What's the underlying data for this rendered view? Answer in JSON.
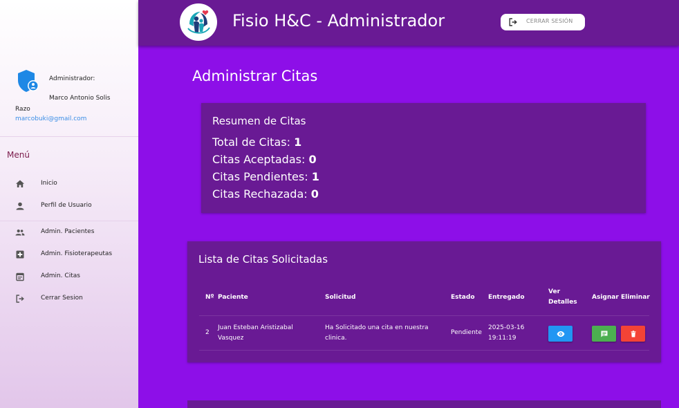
{
  "header": {
    "app_title": "Fisio H&C - Administrador",
    "logout_label": "CERRAR SESIÓN"
  },
  "sidebar": {
    "role_label": "Administrador:",
    "user_name": "Marco Antonio Solis Razo",
    "email": "marcobuki@gmail.com",
    "menu_title": "Menú",
    "items": [
      {
        "label": "Inicio",
        "icon": "home-icon"
      },
      {
        "label": "Perfil de Usuario",
        "icon": "person-icon"
      },
      {
        "label": "Admin. Pacientes",
        "icon": "group-icon"
      },
      {
        "label": "Admin. Fisioterapeutas",
        "icon": "medical-plus-icon"
      },
      {
        "label": "Admin. Citas",
        "icon": "calendar-icon"
      },
      {
        "label": "Cerrar Sesion",
        "icon": "logout-icon"
      }
    ]
  },
  "main": {
    "page_title": "Administrar Citas",
    "summary": {
      "title": "Resumen de Citas",
      "stats": [
        {
          "label": "Total de Citas:",
          "value": "1"
        },
        {
          "label": "Citas Aceptadas:",
          "value": "0"
        },
        {
          "label": "Citas Pendientes:",
          "value": "1"
        },
        {
          "label": "Citas Rechazada:",
          "value": "0"
        }
      ]
    },
    "list": {
      "title": "Lista de Citas Solicitadas",
      "columns": [
        "Nº",
        "Paciente",
        "Solicitud",
        "Estado",
        "Entregado",
        "Ver Detalles",
        "Asignar",
        "Eliminar"
      ],
      "rows": [
        {
          "num": "2",
          "patient": "Juan Esteban Aristizabal Vasquez",
          "request": "Ha Solicitado una cita en nuestra clinica.",
          "status": "Pendiente",
          "delivered": "2025-03-16 19:11:19"
        }
      ]
    }
  },
  "colors": {
    "background": "#8d0fe8",
    "header": "#691a94",
    "card": "#691a94",
    "view_button": "#2196f3",
    "assign_button": "#4caf50",
    "delete_button": "#f44336",
    "email_link": "#3a8ee6"
  }
}
